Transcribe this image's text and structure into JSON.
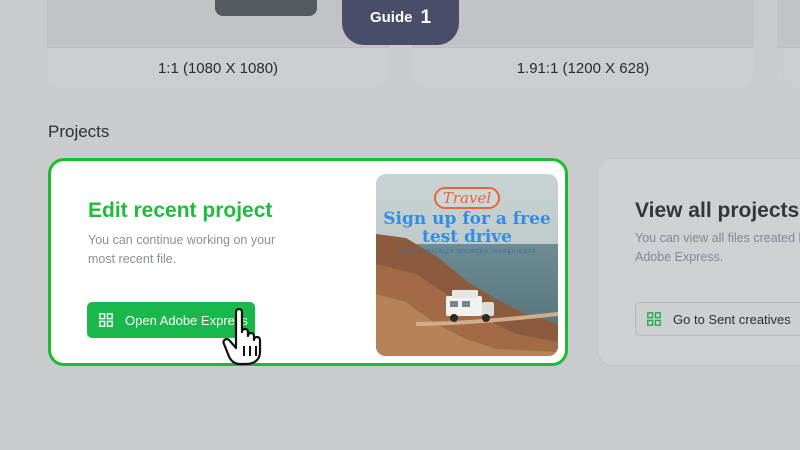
{
  "size_cards": [
    {
      "label": "1:1 (1080 X 1080)"
    },
    {
      "label": "1.91:1 (1200 X 628)"
    }
  ],
  "guide": {
    "label": "Guide",
    "number": "1"
  },
  "projects": {
    "section_title": "Projects",
    "recent": {
      "title": "Edit recent project",
      "description": "You can continue working on your most recent file.",
      "button_label": "Open Adobe Express",
      "preview": {
        "tag": "Travel",
        "headline": "Sign up for a free test drive",
        "subline": "FROM ETHICALLY SOURCED INGREDIENTS"
      }
    },
    "all": {
      "title": "View all projects",
      "description_line1": "You can view all files created b",
      "description_line2": "Adobe Express.",
      "button_label": "Go to Sent creatives"
    }
  },
  "colors": {
    "accent_green": "#1bbd2c",
    "guide_tab": "#4a4d6a",
    "promo_blue": "#2f8fe6",
    "promo_orange": "#e8653a"
  },
  "icons": [
    "grid-icon",
    "pointer-hand-icon"
  ]
}
